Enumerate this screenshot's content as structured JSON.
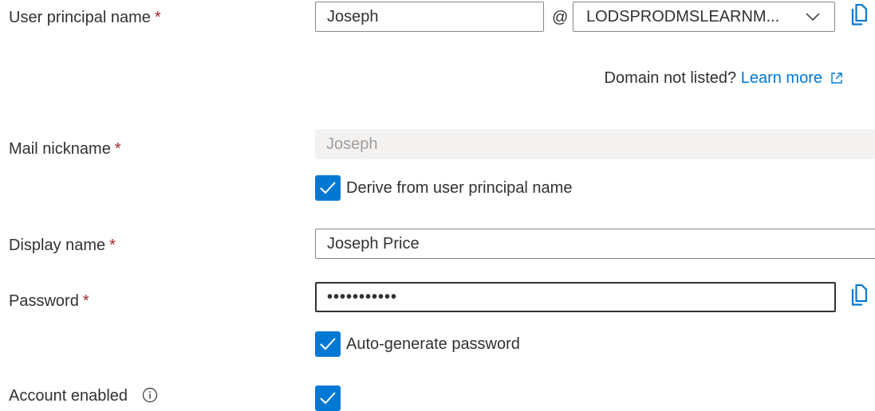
{
  "form": {
    "upn": {
      "label": "User principal name",
      "required_mark": "*",
      "username_value": "Joseph",
      "at_sign": "@",
      "domain_value": "LODSPRODMSLEARNM..."
    },
    "domain_note": {
      "text": "Domain not listed? ",
      "link_text": "Learn more"
    },
    "mail_nickname": {
      "label": "Mail nickname",
      "required_mark": "*",
      "value": "Joseph",
      "derive_checkbox_label": "Derive from user principal name",
      "derive_checked": true
    },
    "display_name": {
      "label": "Display name",
      "required_mark": "*",
      "value": "Joseph Price"
    },
    "password": {
      "label": "Password",
      "required_mark": "*",
      "value": "•••••••••••",
      "autogen_checkbox_label": "Auto-generate password",
      "autogen_checked": true
    },
    "account_enabled": {
      "label": "Account enabled",
      "checked": true
    }
  },
  "icons": {
    "copy": "copy-icon",
    "chevron": "chevron-down-icon",
    "external_link": "external-link-icon",
    "info": "info-icon",
    "checkmark": "checkmark-icon"
  },
  "colors": {
    "accent": "#0078d4",
    "required": "#a4262c",
    "text": "#323130",
    "disabled_bg": "#f3f2f1",
    "disabled_text": "#a19f9d",
    "border": "#8a8886"
  }
}
